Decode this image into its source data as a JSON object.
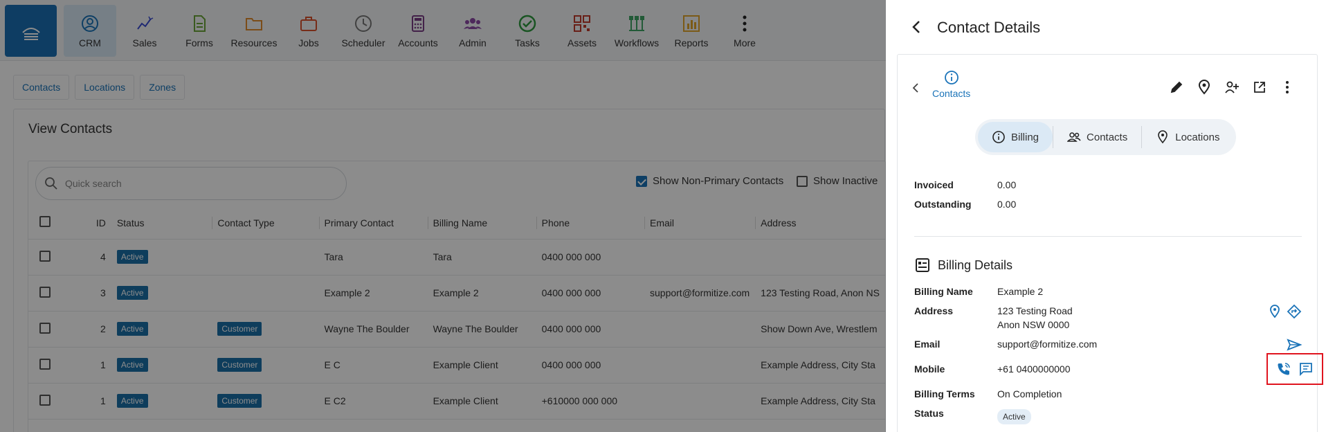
{
  "nav": {
    "items": [
      {
        "key": "crm",
        "label": "CRM",
        "color": "#1a73b8"
      },
      {
        "key": "sales",
        "label": "Sales",
        "color": "#3a4bd1"
      },
      {
        "key": "forms",
        "label": "Forms",
        "color": "#6aa437"
      },
      {
        "key": "resources",
        "label": "Resources",
        "color": "#e08a2c"
      },
      {
        "key": "jobs",
        "label": "Jobs",
        "color": "#d9502c"
      },
      {
        "key": "scheduler",
        "label": "Scheduler",
        "color": "#777777"
      },
      {
        "key": "accounts",
        "label": "Accounts",
        "color": "#7a3d86"
      },
      {
        "key": "admin",
        "label": "Admin",
        "color": "#8c4aa6"
      },
      {
        "key": "tasks",
        "label": "Tasks",
        "color": "#2e9a3e"
      },
      {
        "key": "assets",
        "label": "Assets",
        "color": "#c0392b"
      },
      {
        "key": "workflows",
        "label": "Workflows",
        "color": "#3ea565"
      },
      {
        "key": "reports",
        "label": "Reports",
        "color": "#e0a42a"
      },
      {
        "key": "more",
        "label": "More",
        "color": "#222222"
      }
    ]
  },
  "subtabs": [
    "Contacts",
    "Locations",
    "Zones"
  ],
  "page": {
    "title": "View Contacts"
  },
  "search": {
    "placeholder": "Quick search"
  },
  "filters": {
    "non_primary": "Show Non-Primary Contacts",
    "inactive": "Show Inactive"
  },
  "table": {
    "columns": [
      "ID",
      "Status",
      "Contact Type",
      "Primary Contact",
      "Billing Name",
      "Phone",
      "Email",
      "Address"
    ],
    "rows": [
      {
        "id": "4",
        "status": "Active",
        "type": "",
        "primary": "Tara",
        "billing": "Tara",
        "phone": "0400 000 000",
        "email": "",
        "address": ""
      },
      {
        "id": "3",
        "status": "Active",
        "type": "",
        "primary": "Example 2",
        "billing": "Example 2",
        "phone": "0400 000 000",
        "email": "support@formitize.com",
        "address": "123 Testing Road, Anon NS"
      },
      {
        "id": "2",
        "status": "Active",
        "type": "Customer",
        "primary": "Wayne The Boulder",
        "billing": "Wayne The Boulder",
        "phone": "0400 000 000",
        "email": "",
        "address": "Show Down Ave, Wrestlem"
      },
      {
        "id": "1",
        "status": "Active",
        "type": "Customer",
        "primary": "E C",
        "billing": "Example Client",
        "phone": "0400 000 000",
        "email": "",
        "address": "Example Address, City Sta"
      },
      {
        "id": "1",
        "status": "Active",
        "type": "Customer",
        "primary": "E C2",
        "billing": "Example Client",
        "phone": "+610000 000 000",
        "email": "",
        "address": "Example Address, City Sta"
      }
    ]
  },
  "drawer": {
    "title": "Contact Details",
    "contacts_link": "Contacts",
    "segments": [
      "Billing",
      "Contacts",
      "Locations"
    ],
    "invoiced_label": "Invoiced",
    "invoiced_value": "0.00",
    "outstanding_label": "Outstanding",
    "outstanding_value": "0.00",
    "section_title": "Billing Details",
    "billing_name_label": "Billing Name",
    "billing_name_value": "Example 2",
    "address_label": "Address",
    "address_line1": "123 Testing Road",
    "address_line2": "Anon NSW 0000",
    "email_label": "Email",
    "email_value": "support@formitize.com",
    "mobile_label": "Mobile",
    "mobile_value": "+61 0400000000",
    "terms_label": "Billing Terms",
    "terms_value": "On Completion",
    "status_label": "Status",
    "status_value": "Active"
  }
}
